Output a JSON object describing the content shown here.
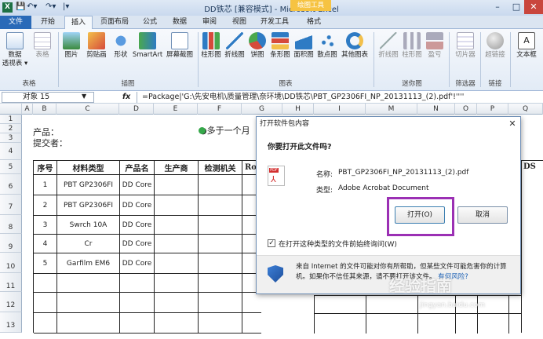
{
  "window": {
    "title": "DD铁芯  [兼容模式] - Microsoft Excel",
    "context_tab": "绘图工具",
    "min": "–",
    "max": "□",
    "close": "✕"
  },
  "tabs": [
    {
      "label": "文件"
    },
    {
      "label": "开始"
    },
    {
      "label": "插入"
    },
    {
      "label": "页面布局"
    },
    {
      "label": "公式"
    },
    {
      "label": "数据"
    },
    {
      "label": "审阅"
    },
    {
      "label": "视图"
    },
    {
      "label": "开发工具"
    },
    {
      "label": "格式"
    }
  ],
  "ribbon": {
    "buttons": [
      {
        "label": "数据",
        "label2": "透视表 ▾",
        "icon": "pivot-table-icon"
      },
      {
        "label": "表格",
        "icon": "table-icon"
      },
      {
        "label": "图片",
        "icon": "picture-icon"
      },
      {
        "label": "剪贴画",
        "icon": "clipart-icon"
      },
      {
        "label": "形状",
        "icon": "shapes-icon"
      },
      {
        "label": "SmartArt",
        "icon": "smartart-icon"
      },
      {
        "label": "屏幕截图",
        "icon": "screenshot-icon"
      },
      {
        "label": "柱形图",
        "icon": "column-chart-icon"
      },
      {
        "label": "折线图",
        "icon": "line-chart-icon"
      },
      {
        "label": "饼图",
        "icon": "pie-chart-icon"
      },
      {
        "label": "条形图",
        "icon": "bar-chart-icon"
      },
      {
        "label": "面积图",
        "icon": "area-chart-icon"
      },
      {
        "label": "散点图",
        "icon": "scatter-chart-icon"
      },
      {
        "label": "其他图表",
        "icon": "other-charts-icon"
      },
      {
        "label": "折线图",
        "icon": "sparkline-line-icon"
      },
      {
        "label": "柱形图",
        "icon": "sparkline-column-icon"
      },
      {
        "label": "盈亏",
        "icon": "sparkline-winloss-icon"
      },
      {
        "label": "切片器",
        "icon": "slicer-icon"
      },
      {
        "label": "超链接",
        "icon": "hyperlink-icon"
      },
      {
        "label": "文本框",
        "icon": "textbox-icon"
      }
    ],
    "groups": [
      "表格",
      "插图",
      "图表",
      "迷你图",
      "筛选器",
      "链接"
    ]
  },
  "formula_bar": {
    "name_box": "对象 15",
    "fx": "fx",
    "formula": "=Package|'G:\\先安电机\\质量管理\\奈环境\\DD铁芯\\PBT_GP2306FI_NP_20131113_(2).pdf'!''''"
  },
  "sheet": {
    "columns": [
      "A",
      "B",
      "C",
      "D",
      "E",
      "F",
      "G",
      "H",
      "I",
      "M",
      "N",
      "O",
      "P",
      "Q"
    ],
    "row_numbers": [
      "1",
      "2",
      "3",
      "4",
      "5",
      "6",
      "7",
      "8",
      "9",
      "10",
      "11",
      "12",
      "13"
    ],
    "label_product": "产品：",
    "label_submitter": "提交者：",
    "bullet_text": "●多于一个月",
    "headers": [
      "序号",
      "材料类型",
      "产品名",
      "生产商",
      "检测机关",
      "Ro"
    ],
    "right_header_fragment": "DS",
    "rows": [
      {
        "no": "1",
        "material": "PBT GP2306FI",
        "product": "DD Core"
      },
      {
        "no": "2",
        "material": "PBT GP2306FI",
        "product": "DD Core"
      },
      {
        "no": "3",
        "material": "Swrch 10A",
        "product": "DD Core"
      },
      {
        "no": "4",
        "material": "Cr",
        "product": "DD Core"
      },
      {
        "no": "5",
        "material": "Garfilm EM6",
        "product": "DD Core"
      }
    ]
  },
  "dialog": {
    "title": "打开软件包内容",
    "question": "你要打开此文件吗?",
    "name_label": "名称:",
    "name_value": "PBT_GP2306FI_NP_20131113_(2).pdf",
    "type_label": "类型:",
    "type_value": "Adobe Acrobat Document",
    "open_button": "打开(O)",
    "cancel_button": "取消",
    "checkbox_label": "在打开这种类型的文件前始终询问(W)",
    "checkbox_checked": true,
    "warning": "来自 Internet 的文件可能对你有所帮助，但某些文件可能危害你的计算机。如果你不信任其来源，请不要打开该文件。",
    "warning_link": "有何风险?",
    "highlight_color": "#9b30b4"
  },
  "watermark": {
    "text": "经验指南",
    "subtext": "jingyan.baidu.com"
  }
}
